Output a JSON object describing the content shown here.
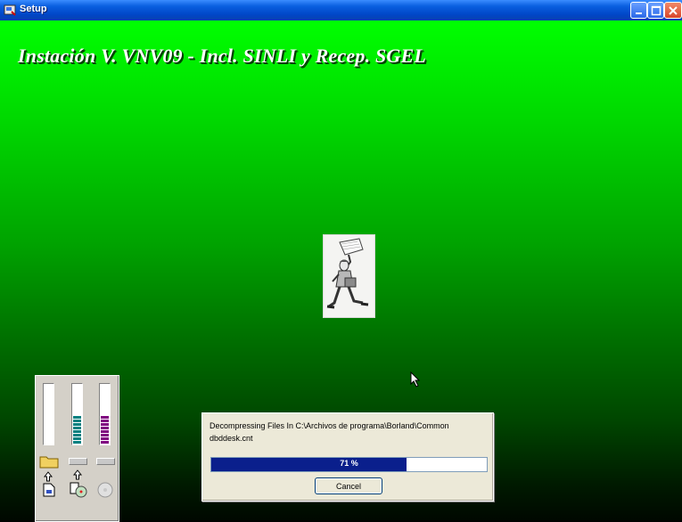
{
  "window": {
    "title": "Setup",
    "controls": [
      "minimize-icon",
      "maximize-icon",
      "close-icon"
    ]
  },
  "installer": {
    "heading": "Instación  V.  VNV09 -  Incl. SINLI y Recep. SGEL",
    "background_top_color": "#00ff00",
    "background_bottom_color": "#000800"
  },
  "meters": {
    "left_meter_level": 0,
    "middle_meter_color": "#008080",
    "right_meter_color": "#800080",
    "icons": [
      "folder-icon",
      "up-arrow-icon",
      "document-icon",
      "disk-icon",
      "cd-icon",
      "drive-icon"
    ]
  },
  "progress": {
    "line1": "Decompressing Files In C:\\Archivos de programa\\Borland\\Common",
    "line2": "dbddesk.cnt",
    "percent_label": "71 %",
    "percent": 71,
    "fill_color": "#0a1f8c",
    "cancel_label": "Cancel"
  }
}
